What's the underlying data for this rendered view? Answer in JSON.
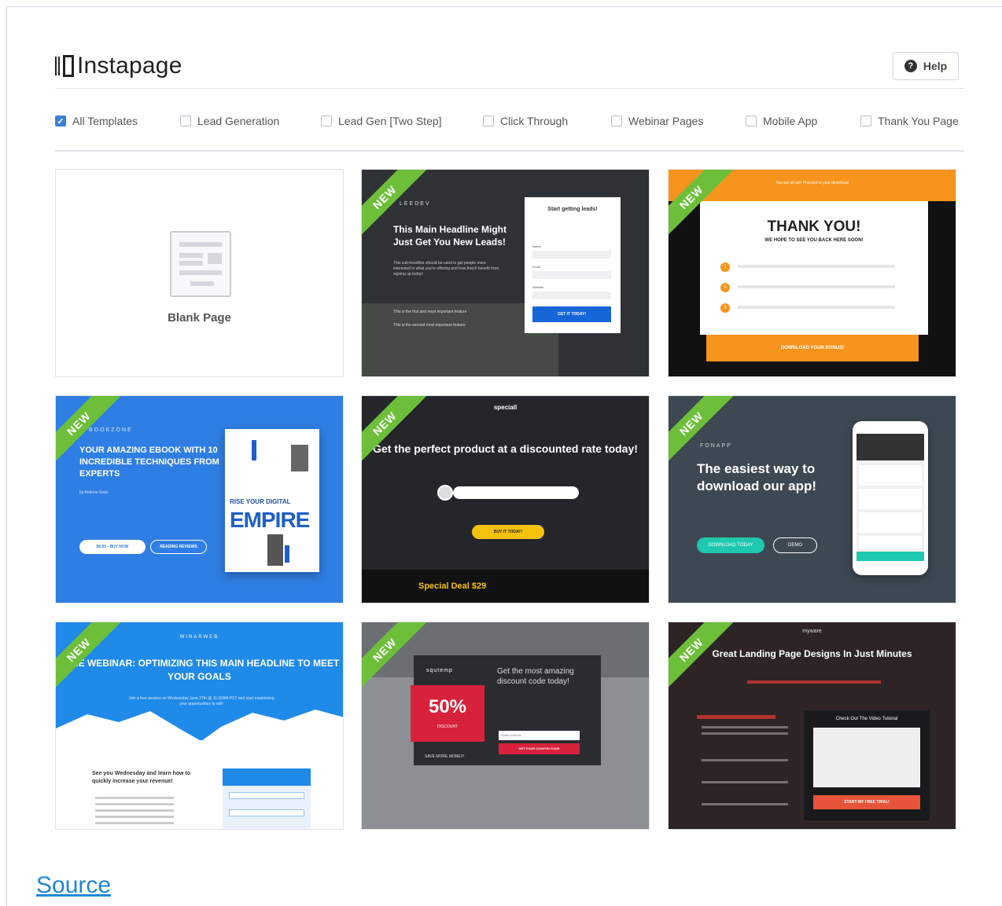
{
  "header": {
    "logo_text": "Instapage",
    "help_label": "Help"
  },
  "filters": [
    {
      "label": "All Templates",
      "checked": true
    },
    {
      "label": "Lead Generation",
      "checked": false
    },
    {
      "label": "Lead Gen [Two Step]",
      "checked": false
    },
    {
      "label": "Click Through",
      "checked": false
    },
    {
      "label": "Webinar Pages",
      "checked": false
    },
    {
      "label": "Mobile App",
      "checked": false
    },
    {
      "label": "Thank You Page",
      "checked": false
    }
  ],
  "templates": {
    "blank": {
      "label": "Blank Page"
    },
    "new_badge": "NEW",
    "leads": {
      "brand": "LEEDEV",
      "headline": "This Main Headline Might Just Get You New Leads!",
      "sub": "This sub-headline should be used to get people more interested in what you're offering and how they'll benefit from signing up today!",
      "bullet1": "This is the first and most important feature",
      "bullet2": "This is the second most important feature",
      "form_title": "Start getting leads!",
      "field_name": "Name",
      "field_email": "Email",
      "field_website": "Website",
      "cta": "GET IT TODAY!"
    },
    "thankyou": {
      "top": "You are all set! Proceed to your download",
      "title": "THANK YOU!",
      "subtitle": "WE HOPE TO SEE YOU BACK HERE SOON!",
      "cta": "DOWNLOAD YOUR BONUS!"
    },
    "ebook": {
      "brand": "BOOKZONE",
      "headline": "YOUR AMAZING EBOOK WITH 10 INCREDIBLE TECHNIQUES FROM EXPERTS",
      "author": "by Andrew Sean",
      "cta1": "$9.99 - BUY NOW",
      "cta2": "READING REVIEWS",
      "book_line1": "RISE YOUR DIGITAL",
      "book_line2": "EMPIRE"
    },
    "coupon": {
      "brand": "speciall",
      "headline": "Get the perfect product at a discounted rate today!",
      "cta": "BUY IT TODAY!",
      "deal": "Special Deal $29"
    },
    "app": {
      "brand": "FONAPP",
      "headline": "The easiest way to download our app!",
      "cta1": "DOWNLOAD TODAY",
      "cta2": "DEMO"
    },
    "webinar": {
      "brand": "WINARWEB",
      "headline": "FREE WEBINAR: OPTIMIZING THIS MAIN HEADLINE TO MEET YOUR GOALS",
      "sub": "Join a free session on Wednesday June 27th @ 11:00AM PST and start maximizing your opportunities to sell!",
      "left_head": "See you Wednesday and learn how to quickly increase your revenue!"
    },
    "discount": {
      "brand": "squtemp",
      "pct": "50%",
      "pct_label": "DISCOUNT",
      "save": "SAVE MORE MONEY!",
      "headline": "Get the most amazing discount code today!",
      "email_placeholder": "Email Address",
      "cta": "GET YOUR COUPON CODE"
    },
    "myware": {
      "brand": "myware",
      "headline": "Great Landing Page Designs In Just Minutes",
      "video_title": "Check Out The Video Tutorial",
      "cta": "START MY FREE TRIAL!"
    }
  },
  "footer": {
    "source_link": "Source"
  }
}
